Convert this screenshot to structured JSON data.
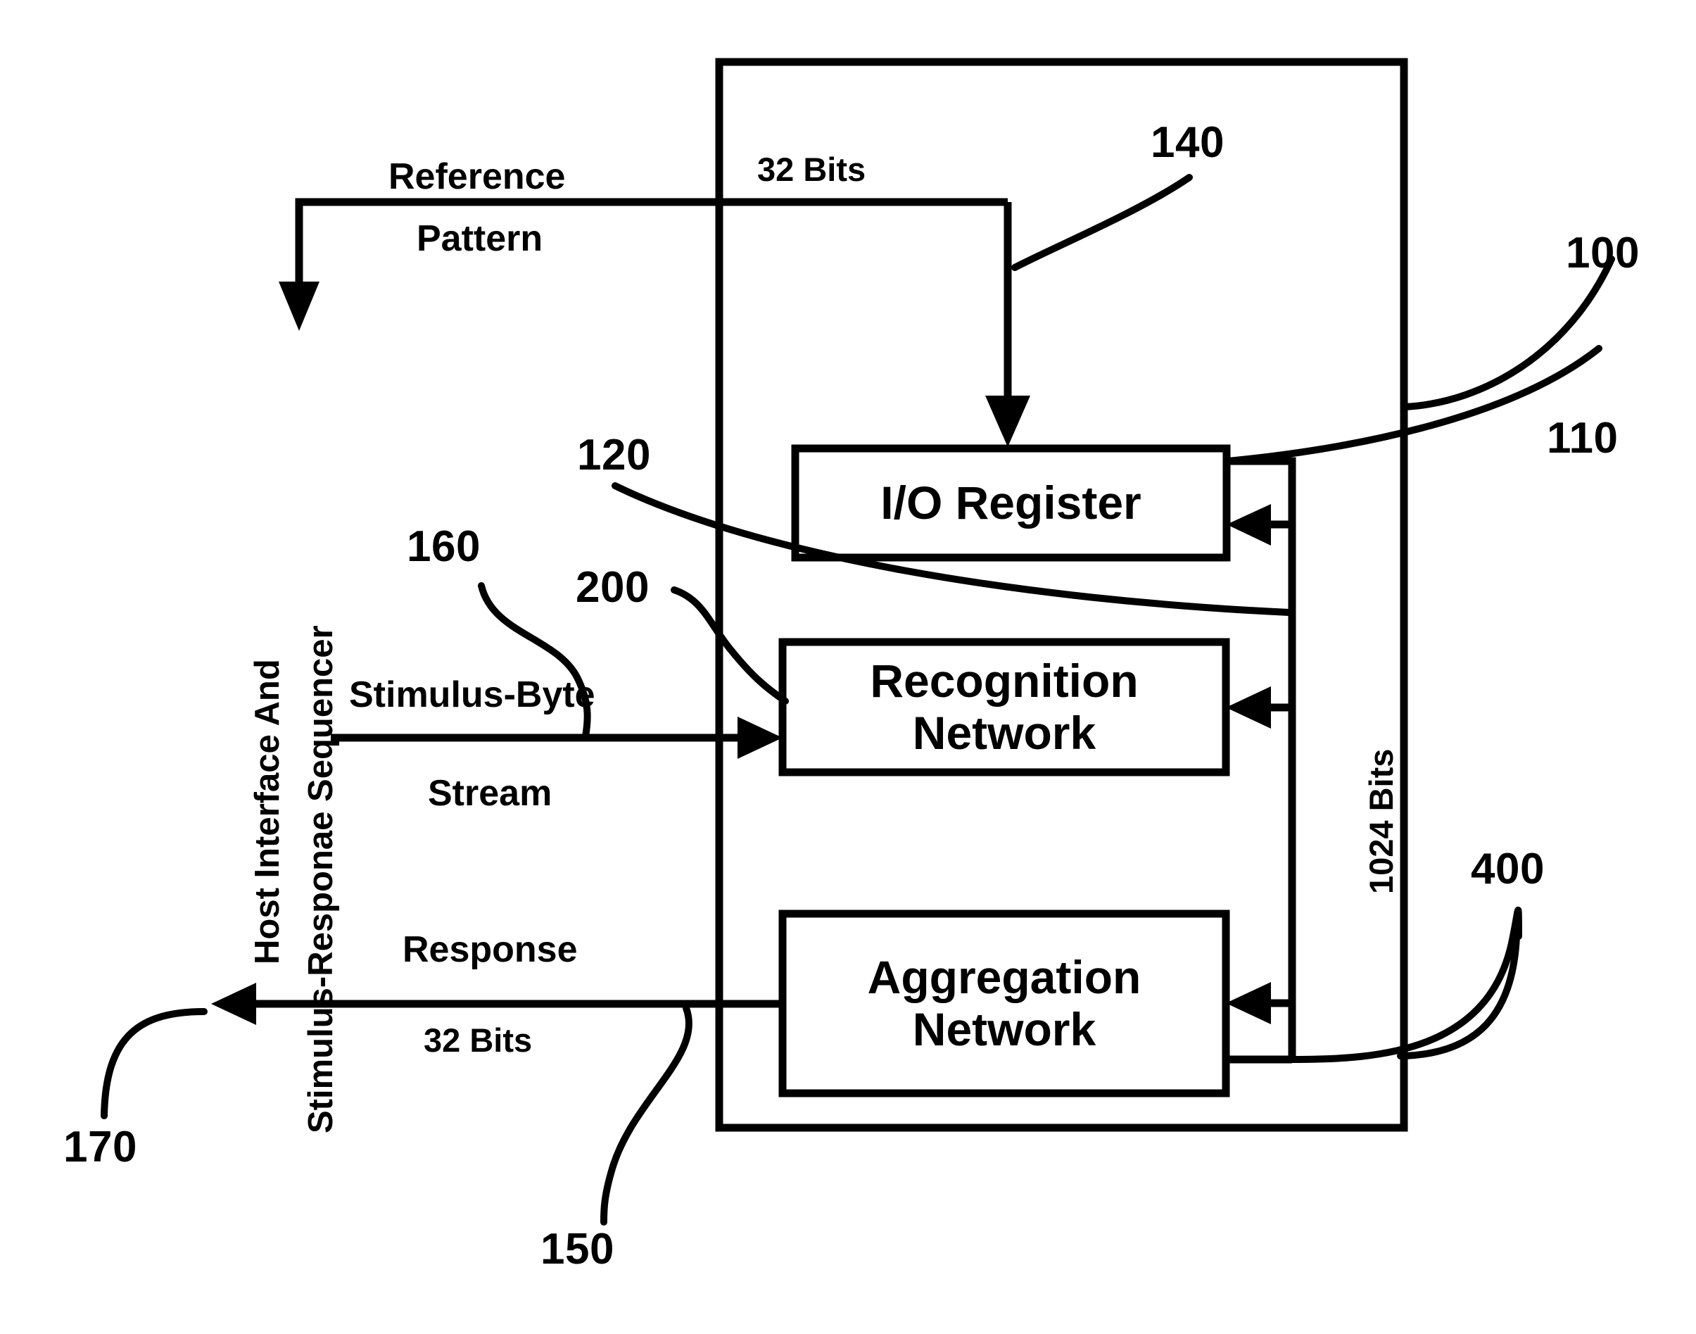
{
  "figure": {
    "type": "patent-block-diagram",
    "outer_block": {
      "label": "",
      "callouts": [
        "100",
        "110"
      ]
    },
    "blocks": [
      {
        "id": "io-register",
        "label": "I/O Register",
        "callout": "110"
      },
      {
        "id": "recognition-net",
        "label_line1": "Recognition",
        "label_line2": "Network",
        "callout": "200"
      },
      {
        "id": "aggregation-net",
        "label_line1": "Aggregation",
        "label_line2": "Network",
        "callout": "400"
      }
    ],
    "signals": {
      "reference_pattern_line1": "Reference",
      "reference_pattern_line2": "Pattern",
      "reference_pattern_width": "32 Bits",
      "stimulus_line1": "Stimulus-Byte",
      "stimulus_line2": "Stream",
      "response_line1": "Response",
      "response_width": "32 Bits",
      "feedback_bus_width": "1024 Bits"
    },
    "host_block": {
      "line1": "Host Interface And",
      "line2": "Stimulus-Responae Sequencer",
      "callout": "170"
    },
    "reference_numerals": {
      "outer_chip": "100",
      "io_register": "110",
      "io_register_bus": "120",
      "reference_input": "140",
      "response_output": "150",
      "stimulus_input": "160",
      "host_interface": "170",
      "recognition_network": "200",
      "aggregation_network": "400"
    },
    "colors": {
      "ink": "#000000",
      "paper": "#ffffff"
    }
  }
}
